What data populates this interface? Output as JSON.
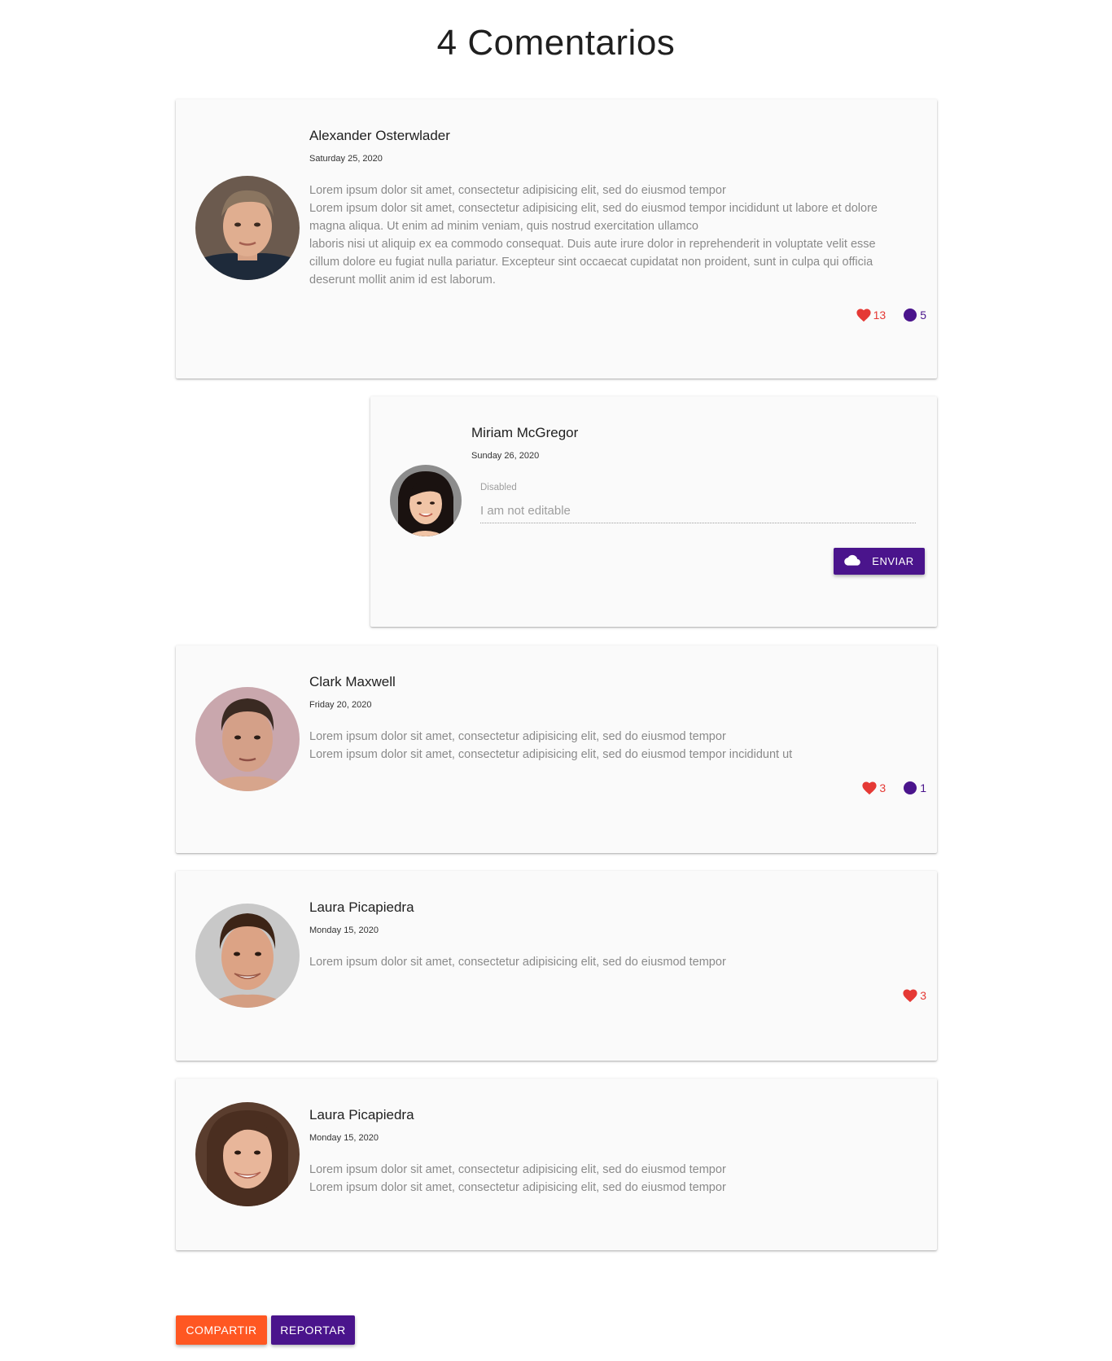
{
  "page": {
    "title": "4 Comentarios"
  },
  "colors": {
    "accent": "#4a148c",
    "like": "#e53935",
    "share": "#ff5722"
  },
  "comments": [
    {
      "author": "Alexander Osterwlader",
      "date": "Saturday 25, 2020",
      "lines": [
        "Lorem ipsum dolor sit amet, consectetur adipisicing elit, sed do eiusmod tempor",
        "Lorem ipsum dolor sit amet, consectetur adipisicing elit, sed do eiusmod tempor incididunt ut labore et dolore",
        "magna aliqua. Ut enim ad minim veniam, quis nostrud exercitation ullamco",
        "laboris nisi ut aliquip ex ea commodo consequat. Duis aute irure dolor in reprehenderit in voluptate velit esse",
        "cillum dolore eu fugiat nulla pariatur. Excepteur sint occaecat cupidatat non proident, sunt in culpa qui officia",
        "deserunt mollit anim id est laborum."
      ],
      "likes": "13",
      "replies": "5"
    },
    {
      "author": "Miriam McGregor",
      "date": "Sunday 26, 2020",
      "field_label": "Disabled",
      "field_value": "I am not editable",
      "send_label": "ENVIAR"
    },
    {
      "author": "Clark Maxwell",
      "date": "Friday 20, 2020",
      "lines": [
        "Lorem ipsum dolor sit amet, consectetur adipisicing elit, sed do eiusmod tempor",
        "Lorem ipsum dolor sit amet, consectetur adipisicing elit, sed do eiusmod tempor incididunt ut"
      ],
      "likes": "3",
      "replies": "1"
    },
    {
      "author": "Laura Picapiedra",
      "date": "Monday 15, 2020",
      "lines": [
        "Lorem ipsum dolor sit amet, consectetur adipisicing elit, sed do eiusmod tempor"
      ],
      "likes": "3"
    },
    {
      "author": "Laura Picapiedra",
      "date": "Monday 15, 2020",
      "lines": [
        "Lorem ipsum dolor sit amet, consectetur adipisicing elit, sed do eiusmod tempor",
        "Lorem ipsum dolor sit amet, consectetur adipisicing elit, sed do eiusmod tempor"
      ]
    }
  ],
  "footer": {
    "share_label": "COMPARTIR",
    "report_label": "REPORTAR"
  }
}
